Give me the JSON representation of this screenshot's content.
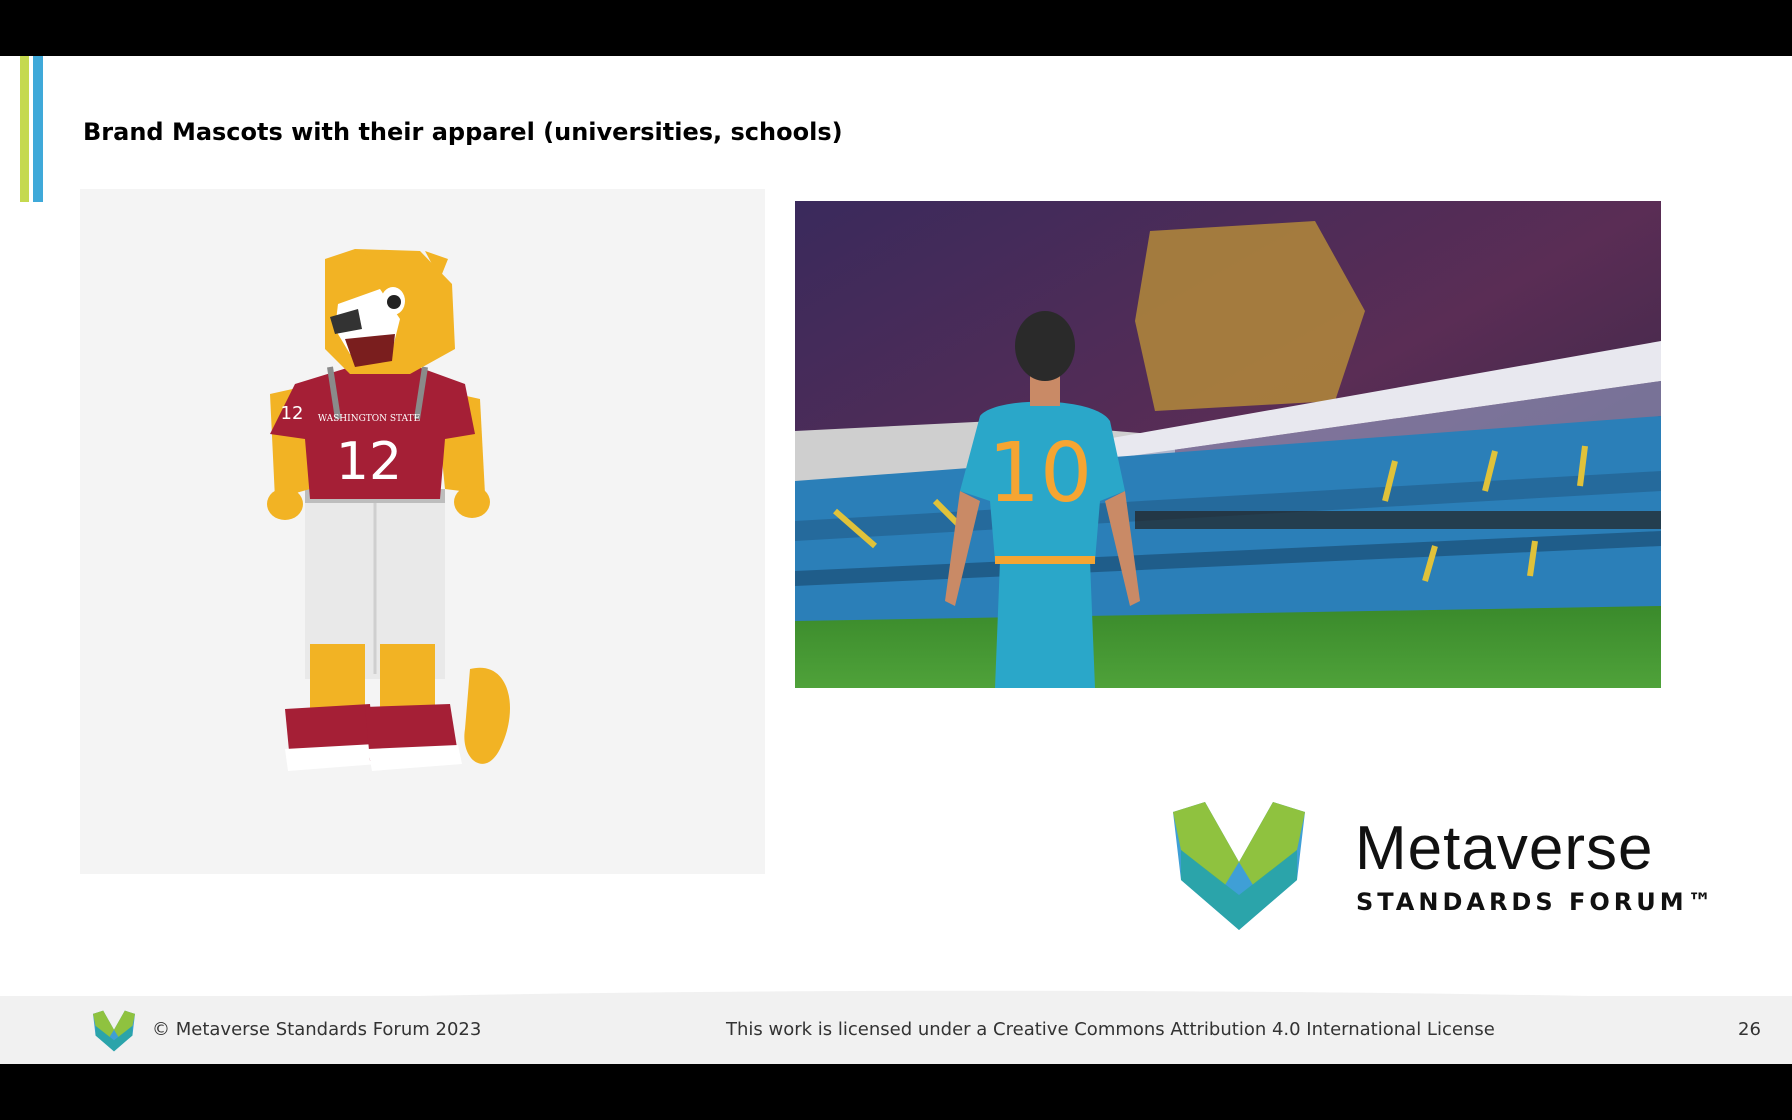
{
  "slide": {
    "title": "Brand Mascots with their apparel (universities, schools)",
    "page_number": "26"
  },
  "mascot_image": {
    "jersey_text": "WASHINGTON STATE",
    "jersey_number": "12",
    "sleeve_number": "12",
    "colors": {
      "fur": "#f2b324",
      "jersey": "#a51f36",
      "pants": "#e6e6e6"
    }
  },
  "stadium_image": {
    "jersey_number": "10",
    "colors": {
      "jersey": "#2aa7c9",
      "number": "#f5a532",
      "pitch": "#3d8f2e",
      "seats": "#2b7fb8"
    }
  },
  "logo": {
    "name": "Metaverse",
    "subtitle": "STANDARDS FORUM™",
    "colors": {
      "green": "#8fc23f",
      "teal": "#25a59b",
      "blue": "#3f9fd6"
    }
  },
  "footer": {
    "copyright": "© Metaverse Standards Forum 2023",
    "license": "This work is licensed under a Creative Commons Attribution 4.0 International License"
  }
}
